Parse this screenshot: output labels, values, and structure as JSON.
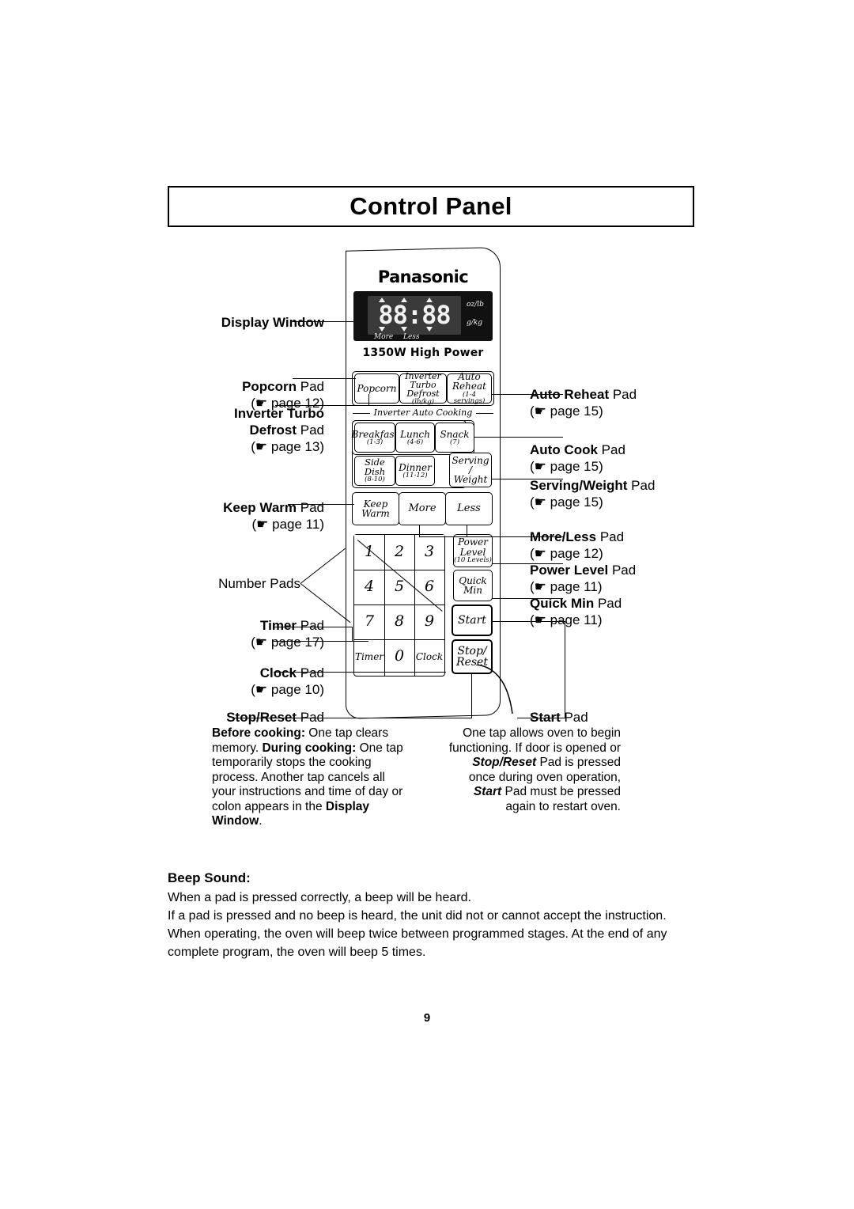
{
  "page": {
    "title": "Control Panel",
    "number": "9"
  },
  "panel": {
    "brand": "Panasonic",
    "display": {
      "digits": "88:88",
      "more": "More",
      "less": "Less",
      "unit_top": "oz/lb",
      "unit_bottom": "g/kg"
    },
    "power_rating": "1350W High Power",
    "auto_cook_caption": "Inverter Auto Cooking",
    "keys": {
      "popcorn": {
        "l1": "Popcorn"
      },
      "inverter_turbo_defrost": {
        "l1": "Inverter",
        "l2": "Turbo",
        "l3": "Defrost",
        "sub": "(lb/kg)"
      },
      "auto_reheat": {
        "l1": "Auto",
        "l2": "Reheat",
        "sub": "(1-4 servings)"
      },
      "breakfast": {
        "l1": "Breakfast",
        "sub": "(1-3)"
      },
      "lunch": {
        "l1": "Lunch",
        "sub": "(4-6)"
      },
      "snack": {
        "l1": "Snack",
        "sub": "(7)"
      },
      "side_dish": {
        "l1": "Side Dish",
        "sub": "(8-10)"
      },
      "dinner": {
        "l1": "Dinner",
        "sub": "(11-12)"
      },
      "serving_weight": {
        "l1": "Serving /",
        "l2": "Weight"
      },
      "keep_warm": {
        "l1": "Keep",
        "l2": "Warm"
      },
      "more": {
        "l1": "More"
      },
      "less": {
        "l1": "Less"
      },
      "power_level": {
        "l1": "Power",
        "l2": "Level",
        "sub": "(10 Levels)"
      },
      "quick_min": {
        "l1": "Quick",
        "l2": "Min"
      },
      "start": {
        "l1": "Start"
      },
      "stop_reset": {
        "l1": "Stop/",
        "l2": "Reset"
      },
      "timer": {
        "l1": "Timer"
      },
      "clock": {
        "l1": "Clock"
      },
      "numbers": [
        "1",
        "2",
        "3",
        "4",
        "5",
        "6",
        "7",
        "8",
        "9",
        "0"
      ]
    }
  },
  "callouts": {
    "display_window": {
      "bold": "Display Window",
      "tail": "",
      "page": ""
    },
    "popcorn": {
      "bold": "Popcorn",
      "tail": " Pad",
      "page": "(☛ page 12)"
    },
    "inverter_turbo_defrost": {
      "bold": "Inverter Turbo",
      "bold2": "Defrost",
      "tail": " Pad",
      "page": "(☛ page 13)"
    },
    "keep_warm": {
      "bold": "Keep Warm",
      "tail": " Pad",
      "page": "(☛ page 11)"
    },
    "number_pads": {
      "bold": "",
      "tail": "Number Pads",
      "page": ""
    },
    "timer": {
      "bold": "Timer",
      "tail": " Pad",
      "page": "(☛ page 17)"
    },
    "clock": {
      "bold": "Clock",
      "tail": " Pad",
      "page": "(☛ page 10)"
    },
    "stop_reset": {
      "bold": "Stop/Reset",
      "tail": " Pad",
      "page": ""
    },
    "auto_reheat": {
      "bold": "Auto Reheat",
      "tail": " Pad",
      "page": "(☛ page 15)"
    },
    "auto_cook": {
      "bold": "Auto Cook",
      "tail": " Pad",
      "page": "(☛ page 15)"
    },
    "serving_weight": {
      "bold": "Serving/Weight",
      "tail": " Pad",
      "page": "(☛ page 15)"
    },
    "more_less": {
      "bold": "More/Less",
      "tail": " Pad",
      "page": "(☛ page 12)"
    },
    "power_level": {
      "bold": "Power Level",
      "tail": " Pad",
      "page": "(☛ page 11)"
    },
    "quick_min": {
      "bold": "Quick Min",
      "tail": " Pad",
      "page": "(☛ page 11)"
    },
    "start": {
      "bold": "Start",
      "tail": " Pad",
      "page": ""
    }
  },
  "descriptions": {
    "stop_reset": {
      "before_label": "Before cooking:",
      "before_text": " One tap clears memory.",
      "during_label": "During cooking:",
      "during_text": " One tap temporarily stops the cooking process. Another tap cancels all your instructions and time of day or colon appears in the ",
      "display_window": "Display Window",
      "period": "."
    },
    "start": {
      "p1": "One tap allows oven to begin functioning. If door is opened or ",
      "stop_reset": "Stop/Reset",
      "p2": " Pad is pressed once during oven operation, ",
      "start": "Start",
      "p3": " Pad must be pressed again to restart oven."
    }
  },
  "beep": {
    "title": "Beep Sound:",
    "line1": "When a pad is pressed correctly, a beep will be heard.",
    "line2": "If a pad is pressed and no beep is heard, the unit did not or cannot accept the instruction.",
    "line3": "When operating, the oven will beep twice between programmed stages. At the end of any complete program, the oven will beep 5 times."
  }
}
